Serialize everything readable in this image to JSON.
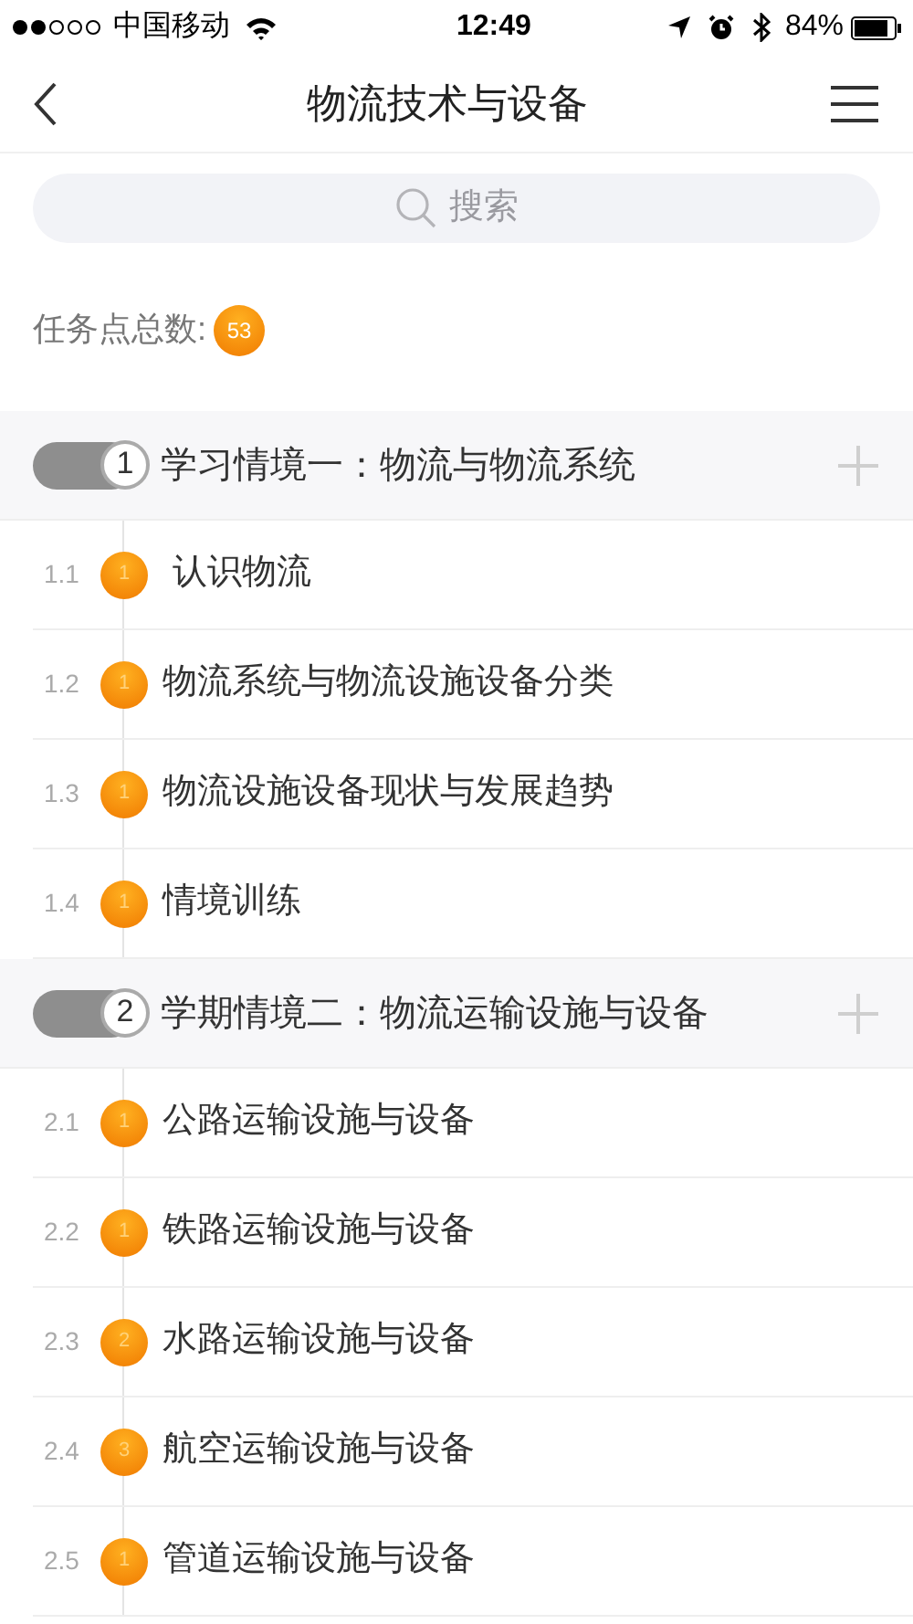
{
  "status_bar": {
    "carrier": "中国移动",
    "time": "12:49",
    "battery": "84%"
  },
  "nav": {
    "title": "物流技术与设备"
  },
  "search": {
    "placeholder": "搜索"
  },
  "task_total": {
    "label": "任务点总数:",
    "count": "53"
  },
  "sections": [
    {
      "number": "1",
      "title": "学习情境一：物流与物流系统",
      "items": [
        {
          "index": "1.1",
          "count": "1",
          "title": " 认识物流"
        },
        {
          "index": "1.2",
          "count": "1",
          "title": "物流系统与物流设施设备分类"
        },
        {
          "index": "1.3",
          "count": "1",
          "title": "物流设施设备现状与发展趋势"
        },
        {
          "index": "1.4",
          "count": "1",
          "title": "情境训练"
        }
      ]
    },
    {
      "number": "2",
      "title": "学期情境二：物流运输设施与设备",
      "items": [
        {
          "index": "2.1",
          "count": "1",
          "title": "公路运输设施与设备"
        },
        {
          "index": "2.2",
          "count": "1",
          "title": "铁路运输设施与设备"
        },
        {
          "index": "2.3",
          "count": "2",
          "title": "水路运输设施与设备"
        },
        {
          "index": "2.4",
          "count": "3",
          "title": "航空运输设施与设备"
        },
        {
          "index": "2.5",
          "count": "1",
          "title": "管道运输设施与设备"
        }
      ]
    }
  ]
}
